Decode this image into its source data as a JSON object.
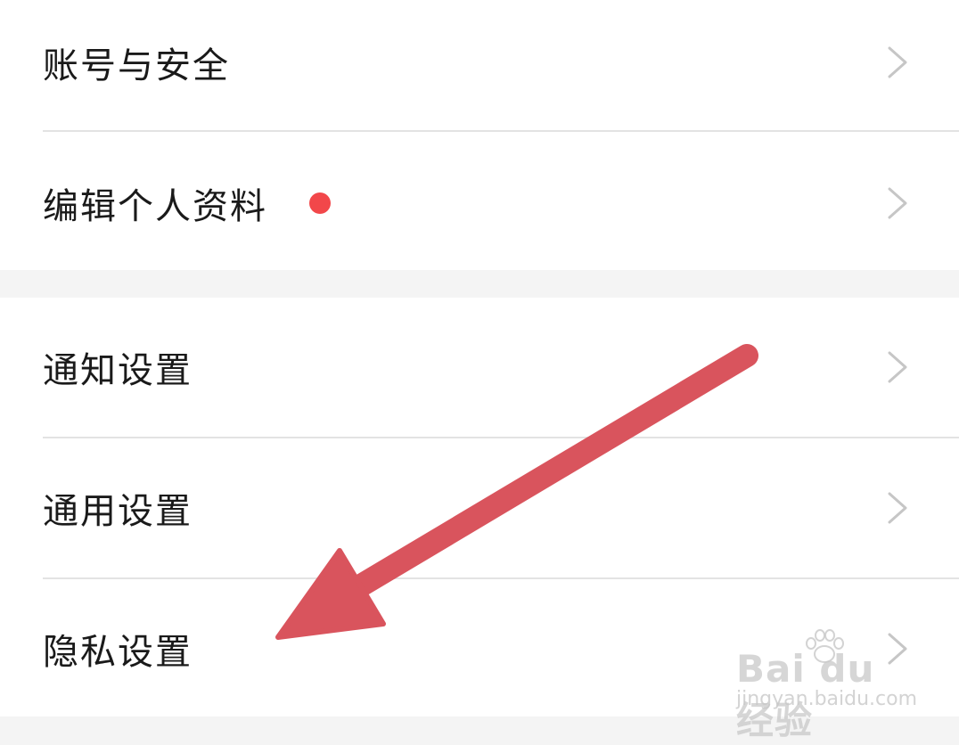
{
  "groups": [
    {
      "items": [
        {
          "label": "账号与安全",
          "chevron": "chevron-right-icon"
        },
        {
          "label": "编辑个人资料",
          "badge": "red-dot",
          "chevron": "chevron-right-icon"
        }
      ]
    },
    {
      "items": [
        {
          "label": "通知设置",
          "chevron": "chevron-right-icon"
        },
        {
          "label": "通用设置",
          "chevron": "chevron-right-icon"
        },
        {
          "label": "隐私设置",
          "chevron": "chevron-right-icon"
        }
      ]
    }
  ],
  "annotation": {
    "type": "arrow",
    "points_to": "隐私设置",
    "color": "#d9545d"
  },
  "watermark": {
    "brand": "Bai du 经验",
    "url": "jingyan.baidu.com"
  },
  "colors": {
    "background": "#f4f4f4",
    "card": "#ffffff",
    "text": "#1a1a1a",
    "chevron": "#c6c6c6",
    "divider": "#e3e3e3",
    "badge": "#f2474a"
  }
}
